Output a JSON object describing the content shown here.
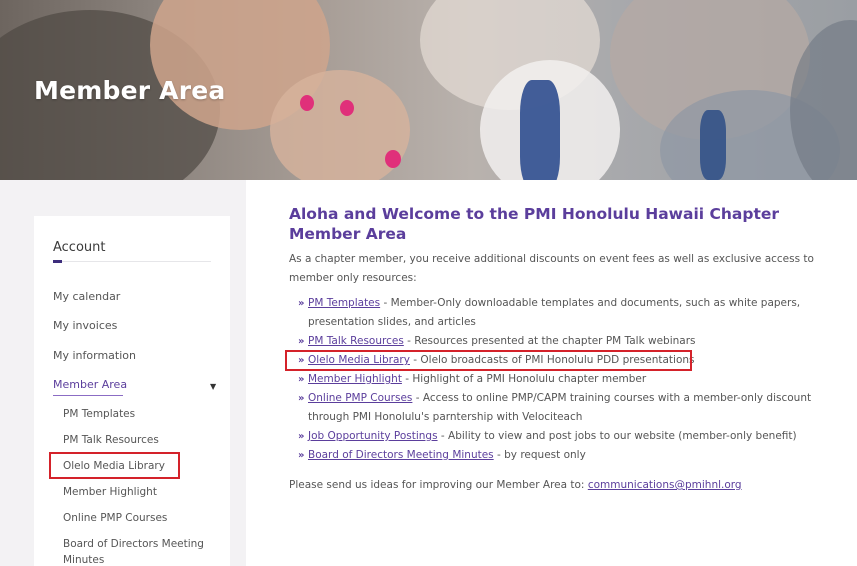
{
  "hero": {
    "title": "Member Area"
  },
  "sidebar": {
    "heading": "Account",
    "items": [
      {
        "label": "My calendar"
      },
      {
        "label": "My invoices"
      },
      {
        "label": "My information"
      },
      {
        "label": "Member Area"
      }
    ],
    "sub_items": [
      {
        "label": "PM Templates"
      },
      {
        "label": "PM Talk Resources"
      },
      {
        "label": "Olelo Media Library"
      },
      {
        "label": "Member Highlight"
      },
      {
        "label": "Online PMP Courses"
      },
      {
        "label": "Board of Directors Meeting"
      },
      {
        "label": "Minutes"
      }
    ]
  },
  "main": {
    "title": "Aloha and Welcome to the PMI Honolulu Hawaii Chapter Member Area",
    "intro": "As a chapter member, you receive additional discounts on event fees as well as exclusive access to member only resources:",
    "resources": [
      {
        "link": "PM Templates",
        "desc": " - Member-Only downloadable templates and documents, such as white papers, presentation slides, and articles"
      },
      {
        "link": "PM Talk Resources",
        "desc": " - Resources presented at the chapter PM Talk webinars"
      },
      {
        "link": "Olelo Media Library",
        "desc": " - Olelo broadcasts of PMI Honolulu PDD presentations"
      },
      {
        "link": "Member Highlight",
        "desc": " - Highlight of a PMI Honolulu chapter member"
      },
      {
        "link": "Online PMP Courses",
        "desc": " - Access to online PMP/CAPM training courses with a member-only discount through PMI Honolulu's parntership with Velociteach"
      },
      {
        "link": "Job Opportunity Postings",
        "desc": " - Ability to view and post jobs to our website (member-only benefit)"
      },
      {
        "link": "Board of Directors Meeting Minutes",
        "desc": " - by request only"
      }
    ],
    "footer_text": "Please send us ideas for improving our Member Area to: ",
    "footer_email": "communications@pmihnl.org"
  },
  "colors": {
    "accent": "#5b3e9c",
    "highlight_box": "#d4222a",
    "sidebar_bg": "#f3f2f4"
  }
}
